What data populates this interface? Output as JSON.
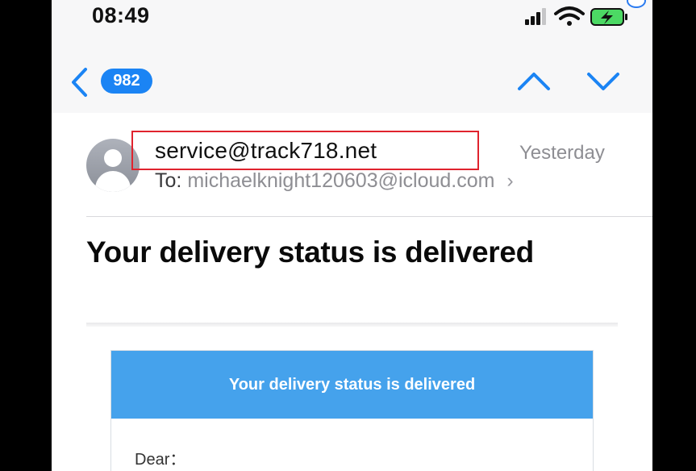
{
  "status_bar": {
    "time": "08:49"
  },
  "nav": {
    "message_count": "982"
  },
  "email": {
    "sender": "service@track718.net",
    "date": "Yesterday",
    "to_label": "To:",
    "recipient": "michaelknight120603@icloud.com",
    "subject": "Your delivery status is delivered"
  },
  "body": {
    "card_title": "Your delivery status is delivered",
    "greeting": "Dear："
  },
  "colors": {
    "accent_blue": "#1b84f4",
    "card_header": "#45a2ec",
    "highlight_red": "#e0232e",
    "battery_green": "#4cd964"
  }
}
